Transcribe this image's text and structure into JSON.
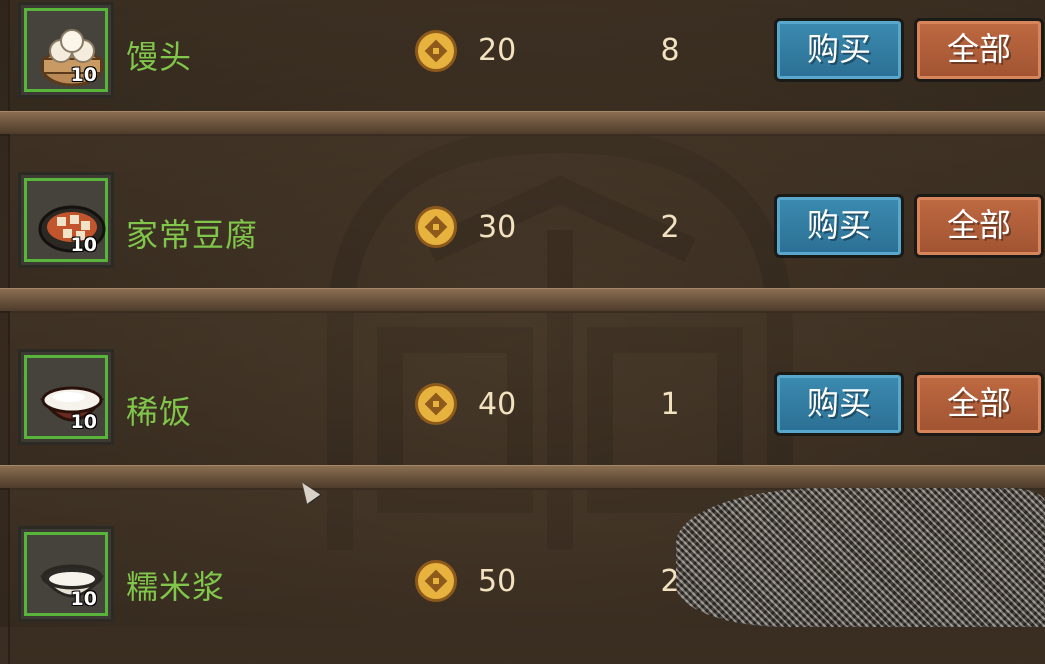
{
  "shop": {
    "items": [
      {
        "name": "馒头",
        "price": "20",
        "stock": "8",
        "slot_qty": "10",
        "icon": "steamed-bun-basket-icon"
      },
      {
        "name": "家常豆腐",
        "price": "30",
        "stock": "2",
        "slot_qty": "10",
        "icon": "tofu-plate-icon"
      },
      {
        "name": "稀饭",
        "price": "40",
        "stock": "1",
        "slot_qty": "10",
        "icon": "rice-porridge-bowl-icon"
      },
      {
        "name": "糯米浆",
        "price": "50",
        "stock": "2",
        "slot_qty": "10",
        "icon": "rice-paste-bowl-icon"
      }
    ],
    "buy_label": "购买",
    "all_label": "全部",
    "currency_icon": "copper-coin-icon"
  },
  "colors": {
    "item_name": "#7fc64a",
    "slot_border": "#58b43a",
    "buy_button": "#2b6f93",
    "all_button": "#a05331",
    "coin": "#e7b23e"
  }
}
